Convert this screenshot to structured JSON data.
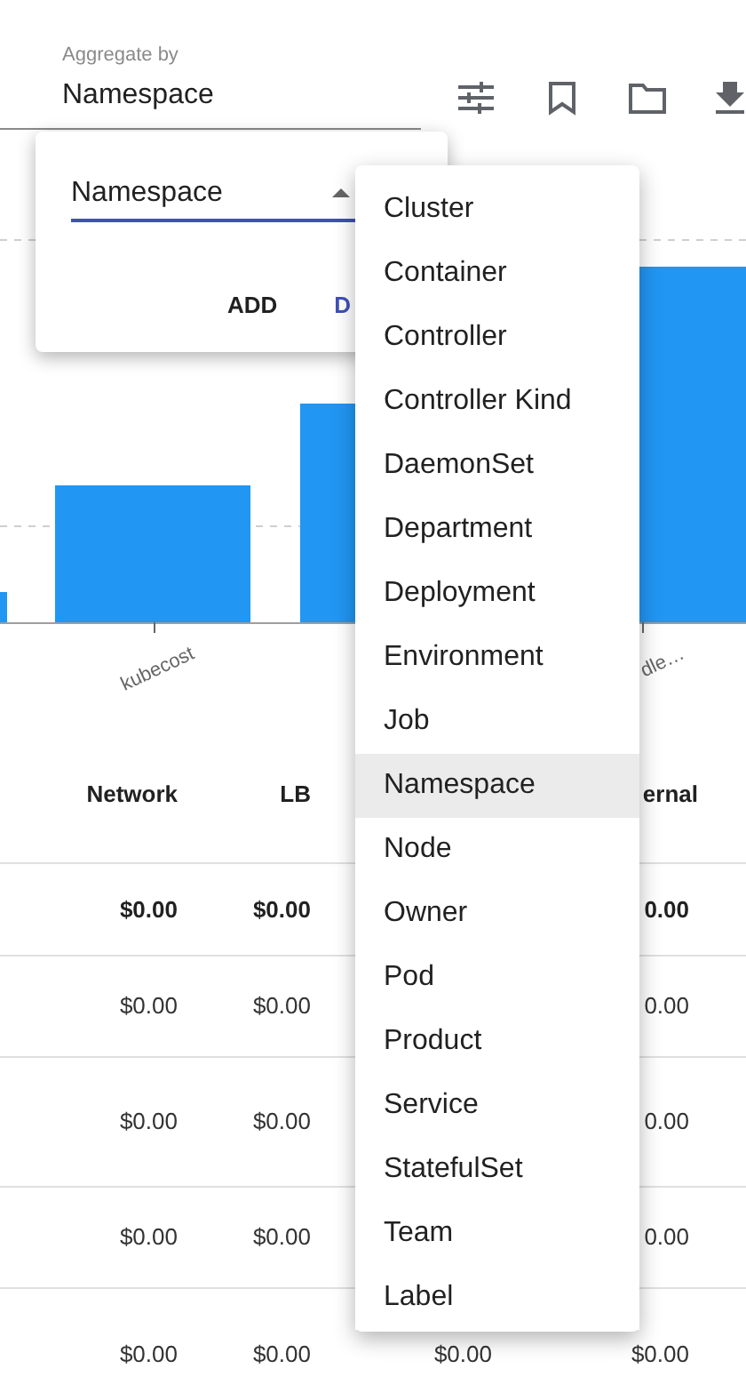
{
  "toolbar": {
    "aggregate_field": {
      "label": "Aggregate by",
      "value": "Namespace"
    }
  },
  "chart": {
    "x_labels": [
      "kubecost",
      "dle…"
    ]
  },
  "table": {
    "columns": [
      {
        "label": "Network"
      },
      {
        "label": "LB"
      },
      {
        "label": "ernal"
      }
    ],
    "rows": [
      {
        "emphasized": true,
        "network": "$0.00",
        "lb": "$0.00",
        "column_4": "0.00"
      },
      {
        "emphasized": false,
        "network": "$0.00",
        "lb": "$0.00",
        "column_4": "0.00"
      },
      {
        "emphasized": false,
        "network": "$0.00",
        "lb": "$0.00",
        "column_4": "0.00"
      },
      {
        "emphasized": false,
        "network": "$0.00",
        "lb": "$0.00",
        "column_4": "0.00"
      },
      {
        "emphasized": false,
        "network": "$0.00",
        "lb": "$0.00",
        "column_3": "$0.00",
        "column_4": "$0.00"
      }
    ]
  },
  "popup": {
    "select": {
      "value": "Namespace",
      "open": true
    },
    "buttons": [
      {
        "label": "ADD",
        "kind": "plain"
      },
      {
        "label": "D",
        "kind": "primary"
      }
    ]
  },
  "menu": {
    "items": [
      {
        "label": "Cluster",
        "selected": false
      },
      {
        "label": "Container",
        "selected": false
      },
      {
        "label": "Controller",
        "selected": false
      },
      {
        "label": "Controller Kind",
        "selected": false
      },
      {
        "label": "DaemonSet",
        "selected": false
      },
      {
        "label": "Department",
        "selected": false
      },
      {
        "label": "Deployment",
        "selected": false
      },
      {
        "label": "Environment",
        "selected": false
      },
      {
        "label": "Job",
        "selected": false
      },
      {
        "label": "Namespace",
        "selected": true
      },
      {
        "label": "Node",
        "selected": false
      },
      {
        "label": "Owner",
        "selected": false
      },
      {
        "label": "Pod",
        "selected": false
      },
      {
        "label": "Product",
        "selected": false
      },
      {
        "label": "Service",
        "selected": false
      },
      {
        "label": "StatefulSet",
        "selected": false
      },
      {
        "label": "Team",
        "selected": false
      },
      {
        "label": "Label",
        "selected": false
      }
    ]
  }
}
